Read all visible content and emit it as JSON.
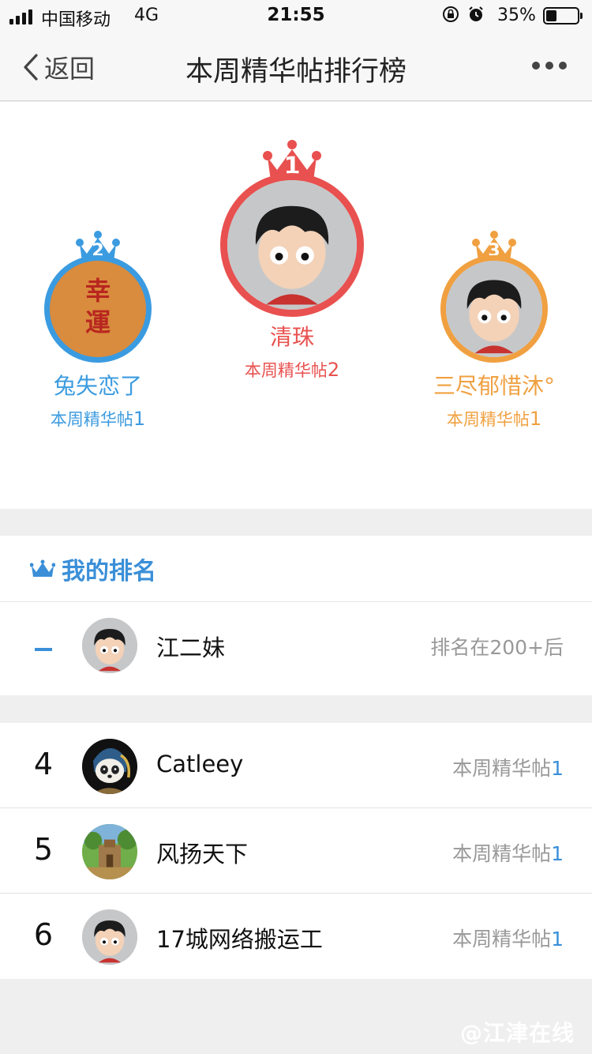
{
  "status": {
    "carrier": "中国移动",
    "network": "4G",
    "time": "21:55",
    "battery": "35%",
    "battery_level": 0.35
  },
  "nav": {
    "back": "返回",
    "title": "本周精华帖排行榜"
  },
  "podium": {
    "first": {
      "rank": "1",
      "name": "清珠",
      "label": "本周精华帖",
      "count": "2",
      "color": "#e8514f"
    },
    "second": {
      "rank": "2",
      "name": "兔失恋了",
      "label": "本周精华帖",
      "count": "1",
      "color": "#3b9be0",
      "avatar_text": [
        "幸",
        "運"
      ]
    },
    "third": {
      "rank": "3",
      "name": "三尽郁惜沐°",
      "label": "本周精华帖",
      "count": "1",
      "color": "#f0a040"
    }
  },
  "my_rank": {
    "heading": "我的排名",
    "name": "江二妹",
    "status": "排名在200+后"
  },
  "ranking": [
    {
      "rank": "4",
      "name": "Catleey",
      "label": "本周精华帖",
      "count": "1",
      "avatar": "panda-avatar"
    },
    {
      "rank": "5",
      "name": "风扬天下",
      "label": "本周精华帖",
      "count": "1",
      "avatar": "scene-avatar"
    },
    {
      "rank": "6",
      "name": "17城网络搬运工",
      "label": "本周精华帖",
      "count": "1",
      "avatar": "default-avatar"
    }
  ],
  "watermark": "@江津在线"
}
